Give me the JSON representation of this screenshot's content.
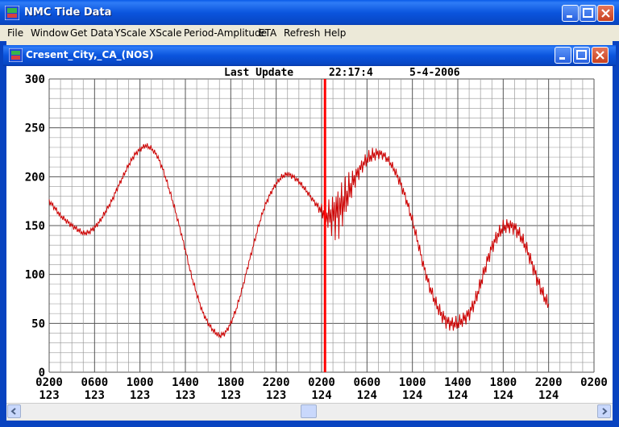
{
  "window": {
    "title": "NMC Tide Data"
  },
  "menu": [
    "File",
    "Window",
    "Get Data",
    "YScale",
    "XScale",
    "Period-Amplitude",
    "ETA",
    "Refresh",
    "Help"
  ],
  "child_window": {
    "title": "Cresent_City,_CA_(NOS)"
  },
  "update": {
    "label": "Last Update",
    "time": "22:17:4",
    "date": "5-4-2006"
  },
  "colors": {
    "series": "#cc0000",
    "now_line": "#ff0000",
    "grid": "#808080",
    "titlebar": "#0a54dd"
  },
  "chart_data": {
    "type": "line",
    "ylim": [
      0,
      300
    ],
    "yticks": [
      0,
      50,
      100,
      150,
      200,
      250,
      300
    ],
    "grid": true,
    "x_hours_range": [
      0,
      48
    ],
    "xticks": [
      {
        "time": "0200",
        "day": "123"
      },
      {
        "time": "0600",
        "day": "123"
      },
      {
        "time": "1000",
        "day": "123"
      },
      {
        "time": "1400",
        "day": "123"
      },
      {
        "time": "1800",
        "day": "123"
      },
      {
        "time": "2200",
        "day": "123"
      },
      {
        "time": "0200",
        "day": "124"
      },
      {
        "time": "0600",
        "day": "124"
      },
      {
        "time": "1000",
        "day": "124"
      },
      {
        "time": "1400",
        "day": "124"
      },
      {
        "time": "1800",
        "day": "124"
      },
      {
        "time": "2200",
        "day": "124"
      },
      {
        "time": "0200",
        "day": ""
      }
    ],
    "current_time_hours": 24.3,
    "series": [
      {
        "x": [
          0,
          0.5,
          1,
          1.5,
          2,
          2.5,
          3,
          3.5,
          4,
          4.5,
          5,
          5.5,
          6,
          6.5,
          7,
          7.5,
          8,
          8.5,
          9,
          9.5,
          10,
          10.5,
          11,
          11.5,
          12,
          12.5,
          13,
          13.5,
          14,
          14.5,
          15,
          15.5,
          16,
          16.5,
          17,
          17.5,
          18,
          18.5,
          19,
          19.5,
          20,
          20.5,
          21,
          21.5,
          22,
          22.5,
          23,
          23.5,
          24,
          24.5,
          25,
          25.5,
          26,
          26.5,
          27,
          27.5,
          28,
          28.5,
          29,
          29.5,
          30,
          30.5,
          31,
          31.5,
          32,
          32.5,
          33,
          33.5,
          34,
          34.5,
          35,
          35.5,
          36,
          36.5,
          37,
          37.5,
          38,
          38.5,
          39,
          39.5,
          40,
          40.5,
          41,
          41.5,
          42,
          42.5,
          43,
          43.5,
          44
        ],
        "y": [
          175,
          168,
          160,
          155,
          150,
          146,
          142,
          143,
          148,
          155,
          165,
          175,
          188,
          200,
          212,
          222,
          228,
          232,
          229,
          222,
          208,
          190,
          170,
          148,
          125,
          100,
          80,
          62,
          50,
          42,
          37,
          40,
          50,
          65,
          85,
          108,
          130,
          152,
          170,
          183,
          193,
          200,
          203,
          200,
          195,
          188,
          180,
          172,
          165,
          160,
          160,
          165,
          175,
          188,
          200,
          210,
          218,
          222,
          224,
          222,
          215,
          205,
          192,
          175,
          155,
          132,
          108,
          88,
          72,
          60,
          52,
          49,
          50,
          54,
          60,
          72,
          90,
          110,
          128,
          140,
          148,
          150,
          148,
          140,
          128,
          112,
          95,
          80,
          68
        ],
        "amplitude_noise": [
          3,
          3,
          3,
          3,
          3,
          3,
          3,
          3,
          3,
          3,
          3,
          3,
          3,
          3,
          3,
          3,
          3,
          3,
          3,
          3,
          3,
          3,
          3,
          3,
          3,
          3,
          3,
          3,
          3,
          3,
          3,
          3,
          3,
          3,
          3,
          3,
          3,
          3,
          3,
          3,
          3,
          3,
          3,
          3,
          3,
          3,
          3,
          3,
          8,
          15,
          25,
          30,
          25,
          18,
          10,
          8,
          8,
          8,
          6,
          5,
          5,
          5,
          6,
          6,
          6,
          6,
          6,
          7,
          7,
          8,
          8,
          8,
          8,
          8,
          8,
          8,
          8,
          8,
          8,
          8,
          8,
          8,
          8,
          8,
          8,
          8,
          8,
          8,
          8
        ]
      }
    ]
  }
}
